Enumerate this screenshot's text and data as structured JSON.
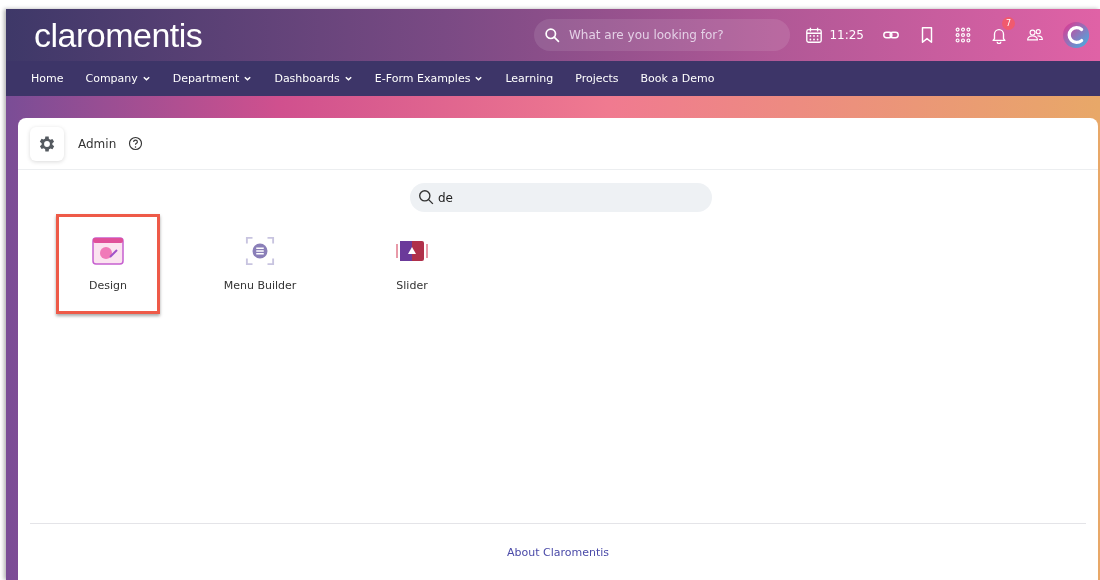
{
  "header": {
    "logo": "claromentis",
    "search": {
      "placeholder": "What are you looking for?"
    },
    "time": "11:25",
    "notification_count": "7"
  },
  "nav": [
    {
      "label": "Home",
      "dropdown": false
    },
    {
      "label": "Company",
      "dropdown": true
    },
    {
      "label": "Department",
      "dropdown": true
    },
    {
      "label": "Dashboards",
      "dropdown": true
    },
    {
      "label": "E-Form Examples",
      "dropdown": true
    },
    {
      "label": "Learning",
      "dropdown": false
    },
    {
      "label": "Projects",
      "dropdown": false
    },
    {
      "label": "Book a Demo",
      "dropdown": false
    }
  ],
  "panel": {
    "title": "Admin",
    "search": {
      "value": "de"
    },
    "apps": [
      {
        "label": "Design",
        "kind": "design",
        "selected": true
      },
      {
        "label": "Menu Builder",
        "kind": "menu",
        "selected": false
      },
      {
        "label": "Slider",
        "kind": "slider",
        "selected": false
      }
    ],
    "footer_link": "About Claromentis"
  }
}
